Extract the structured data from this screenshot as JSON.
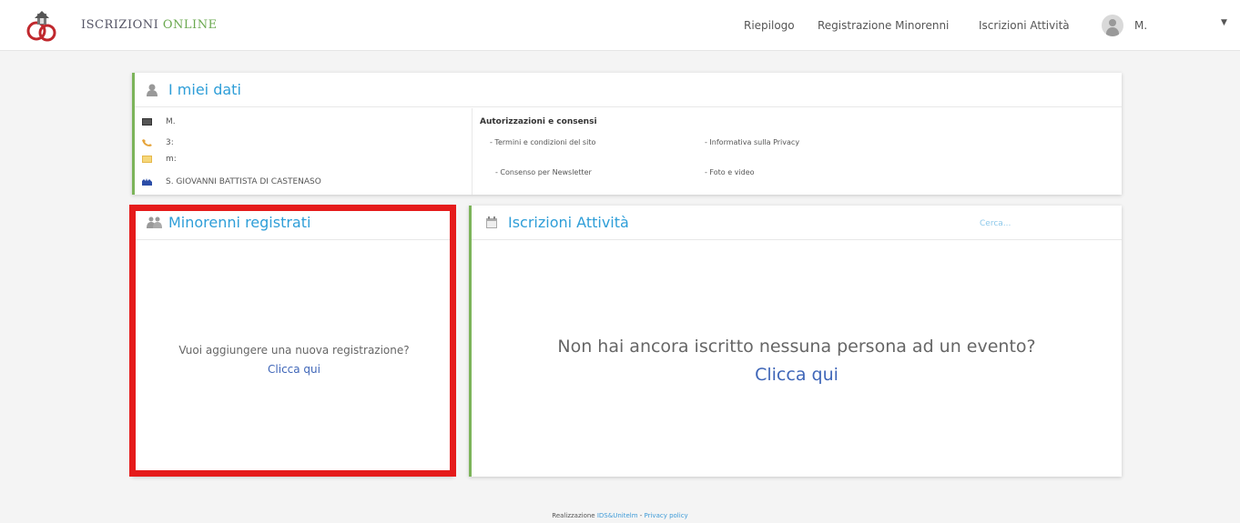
{
  "header": {
    "brand_part1": "ISCRIZIONI ",
    "brand_part2": "ONLINE",
    "nav": [
      "Riepilogo",
      "Registrazione Minorenni",
      "Iscrizioni Attività"
    ],
    "user_name": "M.",
    "caret": "▼"
  },
  "my_data": {
    "title": "I miei dati",
    "name": "M.",
    "phone": "3:",
    "email": "m:",
    "parish": "S. GIOVANNI BATTISTA DI CASTENASO",
    "consents_title": "Autorizzazioni e consensi",
    "consents": [
      "- Termini e condizioni del sito",
      "- Informativa sulla Privacy",
      "- Consenso per Newsletter",
      "- Foto e video"
    ]
  },
  "minors": {
    "title": "Minorenni registrati",
    "prompt": "Vuoi aggiungere una nuova registrazione?",
    "link": "Clicca qui"
  },
  "activities": {
    "title": "Iscrizioni Attività",
    "search_placeholder": "Cerca...",
    "prompt": "Non hai ancora iscritto nessuna persona ad un evento?",
    "link": "Clicca qui"
  },
  "footer": {
    "prefix": "Realizzazione ",
    "company": "IDS&Unitelm",
    "separator": " - ",
    "privacy": "Privacy policy"
  },
  "colors": {
    "accent_blue": "#2e9ed8",
    "accent_green": "#7cb45a",
    "highlight_red": "#e51b1b",
    "link_blue": "#3f66b8"
  }
}
